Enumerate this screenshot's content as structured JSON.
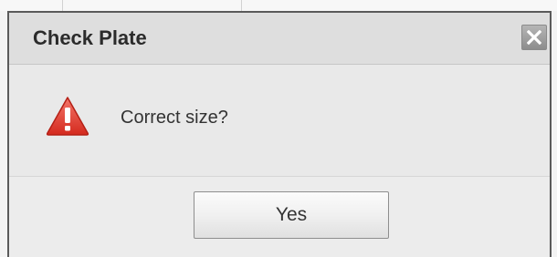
{
  "dialog": {
    "title": "Check Plate",
    "close_icon": "close-icon",
    "message": "Correct size?",
    "message_icon": "warning-icon",
    "button_label": "Yes"
  },
  "colors": {
    "title_bar": "#dedede",
    "dialog_border": "#5a5a5a",
    "warning_red": "#e23a2c"
  }
}
